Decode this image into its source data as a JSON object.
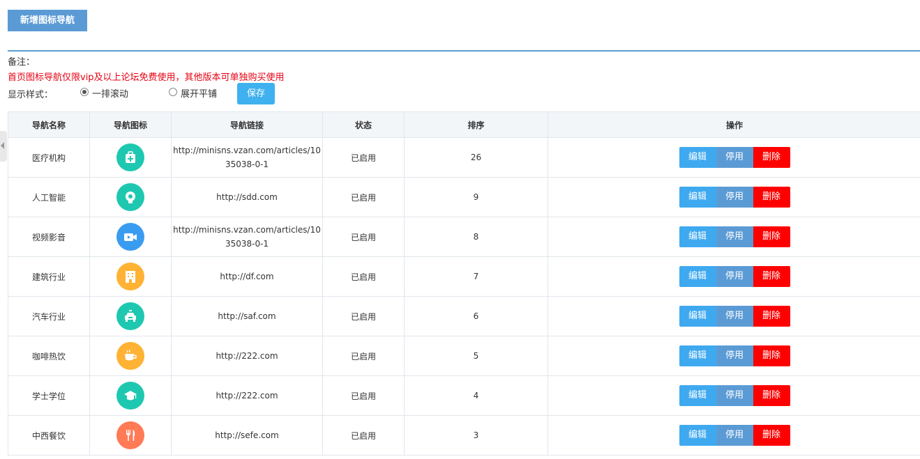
{
  "toolbar": {
    "add_label": "新增图标导航"
  },
  "notes": {
    "label": "备注：",
    "warning": "首页图标导航仅限vip及以上论坛免费使用，其他版本可单独购买使用"
  },
  "display_style": {
    "label": "显示样式：",
    "options": [
      "一排滚动",
      "展开平铺"
    ],
    "selected": "一排滚动",
    "save_label": "保存"
  },
  "table": {
    "headers": {
      "name": "导航名称",
      "icon": "导航图标",
      "link": "导航链接",
      "status": "状态",
      "order": "排序",
      "actions": "操作"
    },
    "action_labels": {
      "edit": "编辑",
      "disable": "停用",
      "delete": "删除"
    },
    "rows": [
      {
        "name": "医疗机构",
        "icon": "medical-kit-icon",
        "icon_color": "#1ec8b0",
        "link": "http://minisns.vzan.com/articles/1035038-0-1",
        "status": "已启用",
        "order": "26"
      },
      {
        "name": "人工智能",
        "icon": "robot-icon",
        "icon_color": "#1ec8b0",
        "link": "http://sdd.com",
        "status": "已启用",
        "order": "9"
      },
      {
        "name": "视频影音",
        "icon": "video-camera-icon",
        "icon_color": "#3a9cf0",
        "link": "http://minisns.vzan.com/articles/1035038-0-1",
        "status": "已启用",
        "order": "8"
      },
      {
        "name": "建筑行业",
        "icon": "building-icon",
        "icon_color": "#ffb233",
        "link": "http://df.com",
        "status": "已启用",
        "order": "7"
      },
      {
        "name": "汽车行业",
        "icon": "car-icon",
        "icon_color": "#1ec8b0",
        "link": "http://saf.com",
        "status": "已启用",
        "order": "6"
      },
      {
        "name": "咖啡热饮",
        "icon": "coffee-cup-icon",
        "icon_color": "#ffb233",
        "link": "http://222.com",
        "status": "已启用",
        "order": "5"
      },
      {
        "name": "学士学位",
        "icon": "graduation-cap-icon",
        "icon_color": "#1ec8b0",
        "link": "http://222.com",
        "status": "已启用",
        "order": "4"
      },
      {
        "name": "中西餐饮",
        "icon": "fork-knife-icon",
        "icon_color": "#ff7a55",
        "link": "http://sefe.com",
        "status": "已启用",
        "order": "3"
      }
    ]
  }
}
